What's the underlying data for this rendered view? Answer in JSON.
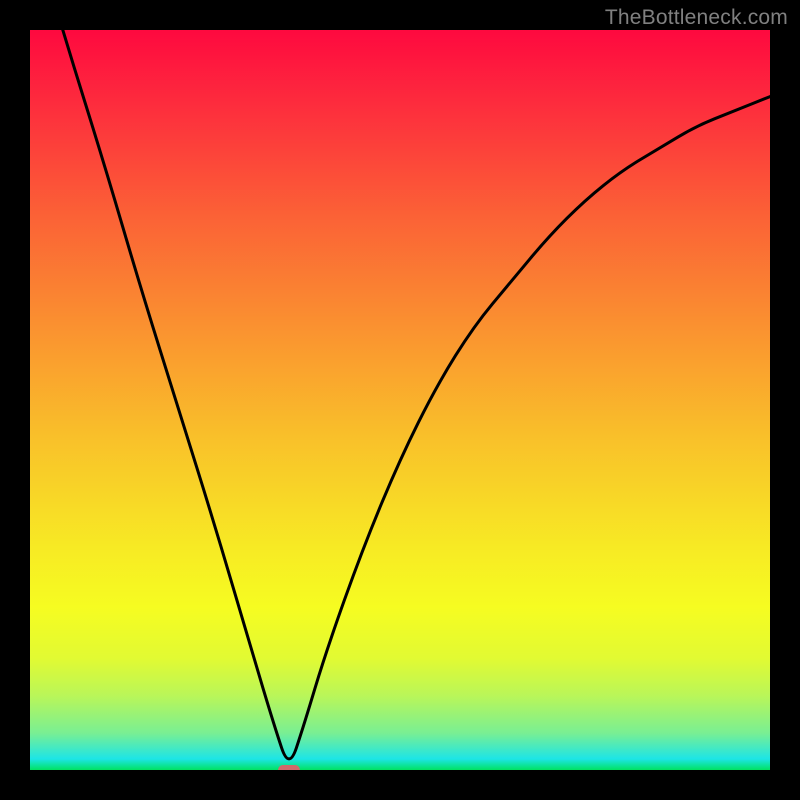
{
  "watermark": "TheBottleneck.com",
  "chart_data": {
    "type": "line",
    "title": "",
    "xlabel": "",
    "ylabel": "",
    "xlim": [
      0,
      100
    ],
    "ylim": [
      0,
      100
    ],
    "curve": {
      "name": "bottleneck-curve",
      "x": [
        0,
        5,
        10,
        15,
        20,
        25,
        30,
        33,
        35,
        37,
        40,
        45,
        50,
        55,
        60,
        65,
        70,
        75,
        80,
        85,
        90,
        95,
        100
      ],
      "y": [
        115,
        98,
        82,
        65,
        49,
        33,
        16,
        6,
        0,
        6,
        16,
        30,
        42,
        52,
        60,
        66,
        72,
        77,
        81,
        84,
        87,
        89,
        91
      ]
    },
    "marker": {
      "x": 35,
      "y": 0,
      "color": "#d06a6a"
    },
    "gradient_stops": [
      {
        "pos": 0.0,
        "color": "#fe093f"
      },
      {
        "pos": 0.1,
        "color": "#fd2c3d"
      },
      {
        "pos": 0.25,
        "color": "#fb6136"
      },
      {
        "pos": 0.4,
        "color": "#fa9130"
      },
      {
        "pos": 0.55,
        "color": "#f9c02a"
      },
      {
        "pos": 0.7,
        "color": "#f7ea24"
      },
      {
        "pos": 0.78,
        "color": "#f6fc21"
      },
      {
        "pos": 0.85,
        "color": "#e1fa33"
      },
      {
        "pos": 0.9,
        "color": "#b9f659"
      },
      {
        "pos": 0.95,
        "color": "#79ef93"
      },
      {
        "pos": 0.985,
        "color": "#1de5e6"
      },
      {
        "pos": 1.0,
        "color": "#00e261"
      }
    ]
  }
}
